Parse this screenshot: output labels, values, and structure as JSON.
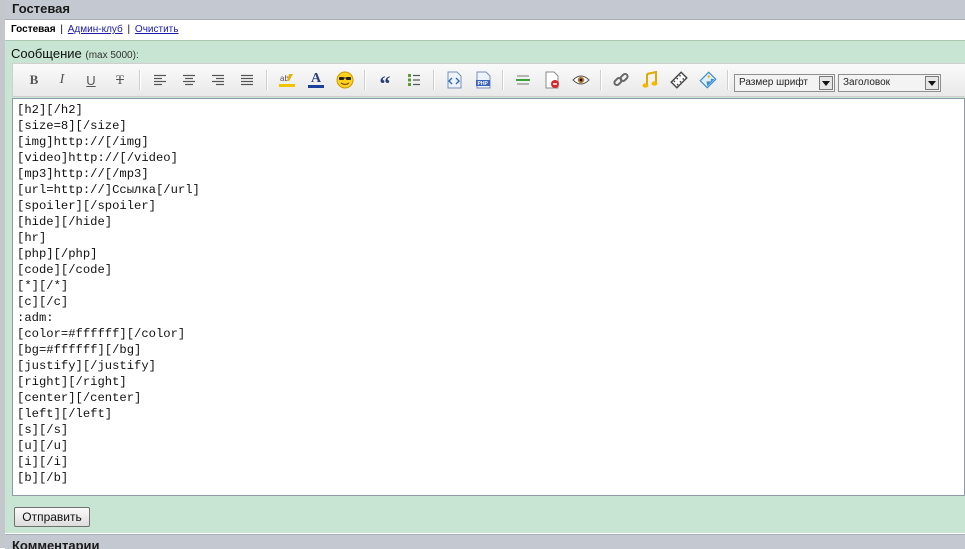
{
  "header": {
    "title": "Гостевая"
  },
  "nav": {
    "current": "Гостевая",
    "sep1": "|",
    "admin_link": "Админ-клуб",
    "sep2": "|",
    "clear_link": "Очистить"
  },
  "form": {
    "label": "Сообщение",
    "max_hint": "(max 5000):",
    "submit_label": "Отправить"
  },
  "toolbar": {
    "bold": "B",
    "italic": "I",
    "underline": "U",
    "strike": "T",
    "font_color": "A",
    "quote": "66",
    "php": "PHP",
    "font_size_select": "Размер шрифт",
    "heading_select": "Заголовок"
  },
  "editor": {
    "text": "[h2][/h2]\n[size=8][/size]\n[img]http://[/img]\n[video]http://[/video]\n[mp3]http://[/mp3]\n[url=http://]Ссылка[/url]\n[spoiler][/spoiler]\n[hide][/hide]\n[hr]\n[php][/php]\n[code][/code]\n[*][/*]\n[c][/c]\n:adm:\n[color=#ffffff][/color]\n[bg=#ffffff][/bg]\n[justify][/justify]\n[right][/right]\n[center][/center]\n[left][/left]\n[s][/s]\n[u][/u]\n[i][/i]\n[b][/b]"
  },
  "comments": {
    "title": "Комментарии"
  },
  "colors": {
    "header_bg": "#c4c9d1",
    "form_bg": "#c7e5d2",
    "link": "#1a1aa8"
  }
}
